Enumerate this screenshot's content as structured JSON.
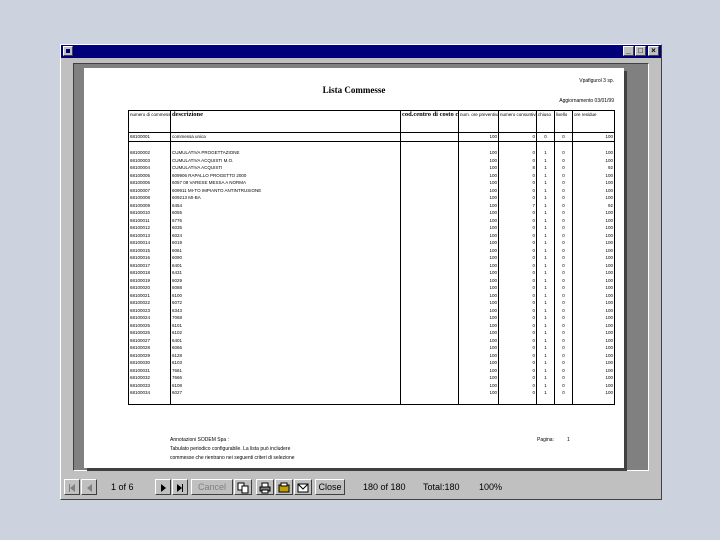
{
  "window": {
    "buttons": {
      "minimize": "_",
      "maximize": "□",
      "close": "×"
    }
  },
  "report": {
    "company": "Vpafigurol 3 sp.",
    "title": "Lista Commesse",
    "updated": "Aggiornamento 03/01/99",
    "columns": [
      {
        "label": "numero di commessa"
      },
      {
        "label": "descrizione"
      },
      {
        "label": "cod.centro di costo cliente"
      },
      {
        "label": "num. ore preventivate"
      },
      {
        "label": "numero consuntivi"
      },
      {
        "label": "chiuso"
      },
      {
        "label": "livello"
      },
      {
        "label": "ore residue"
      }
    ],
    "rows": [
      {
        "code": "68100001",
        "desc": "commessa unica",
        "cdc": "",
        "ore": "100",
        "cons": "0",
        "chiuso": "0",
        "liv": "0",
        "res": "100"
      },
      {
        "code": "",
        "desc": "",
        "cdc": "",
        "ore": "",
        "cons": "",
        "chiuso": "",
        "liv": "",
        "res": ""
      },
      {
        "code": "68100002",
        "desc": "CUMULATIVA PROGETTAZIONE",
        "cdc": "",
        "ore": "100",
        "cons": "0",
        "chiuso": "1",
        "liv": "0",
        "res": "100"
      },
      {
        "code": "68100003",
        "desc": "CUMULATIVA ACQUISTI M.O.",
        "cdc": "",
        "ore": "100",
        "cons": "0",
        "chiuso": "1",
        "liv": "0",
        "res": "100"
      },
      {
        "code": "68100004",
        "desc": "CUMULATIVA ACQUISTI",
        "cdc": "",
        "ore": "100",
        "cons": "8",
        "chiuso": "1",
        "liv": "0",
        "res": "92"
      },
      {
        "code": "68100005",
        "desc": "609906 RAPALLO PROGETTO 2000",
        "cdc": "",
        "ore": "100",
        "cons": "0",
        "chiuso": "1",
        "liv": "0",
        "res": "100"
      },
      {
        "code": "68100006",
        "desc": "6057 08 VARESE MESSA A NORMA",
        "cdc": "",
        "ore": "100",
        "cons": "0",
        "chiuso": "1",
        "liv": "0",
        "res": "100"
      },
      {
        "code": "68100007",
        "desc": "609911 MI-TO IMPIANTO ANTINTRUSIONE",
        "cdc": "",
        "ore": "100",
        "cons": "0",
        "chiuso": "1",
        "liv": "0",
        "res": "100"
      },
      {
        "code": "68100008",
        "desc": "609213 MI-BA",
        "cdc": "",
        "ore": "100",
        "cons": "0",
        "chiuso": "1",
        "liv": "0",
        "res": "100"
      },
      {
        "code": "68100009",
        "desc": "6454",
        "cdc": "",
        "ore": "100",
        "cons": "7",
        "chiuso": "1",
        "liv": "0",
        "res": "92"
      },
      {
        "code": "68100010",
        "desc": "6055",
        "cdc": "",
        "ore": "100",
        "cons": "0",
        "chiuso": "1",
        "liv": "0",
        "res": "100"
      },
      {
        "code": "68100011",
        "desc": "6776",
        "cdc": "",
        "ore": "100",
        "cons": "0",
        "chiuso": "1",
        "liv": "0",
        "res": "100"
      },
      {
        "code": "68100012",
        "desc": "6035",
        "cdc": "",
        "ore": "100",
        "cons": "0",
        "chiuso": "1",
        "liv": "0",
        "res": "100"
      },
      {
        "code": "68100013",
        "desc": "6024",
        "cdc": "",
        "ore": "100",
        "cons": "0",
        "chiuso": "1",
        "liv": "0",
        "res": "100"
      },
      {
        "code": "68100014",
        "desc": "6019",
        "cdc": "",
        "ore": "100",
        "cons": "0",
        "chiuso": "1",
        "liv": "0",
        "res": "100"
      },
      {
        "code": "68100015",
        "desc": "6061",
        "cdc": "",
        "ore": "100",
        "cons": "0",
        "chiuso": "1",
        "liv": "0",
        "res": "100"
      },
      {
        "code": "68100016",
        "desc": "6090",
        "cdc": "",
        "ore": "100",
        "cons": "0",
        "chiuso": "1",
        "liv": "0",
        "res": "100"
      },
      {
        "code": "68100017",
        "desc": "6401",
        "cdc": "",
        "ore": "100",
        "cons": "0",
        "chiuso": "1",
        "liv": "0",
        "res": "100"
      },
      {
        "code": "68100018",
        "desc": "6431",
        "cdc": "",
        "ore": "100",
        "cons": "0",
        "chiuso": "1",
        "liv": "0",
        "res": "100"
      },
      {
        "code": "68100019",
        "desc": "6029",
        "cdc": "",
        "ore": "100",
        "cons": "0",
        "chiuso": "1",
        "liv": "0",
        "res": "100"
      },
      {
        "code": "68100020",
        "desc": "6088",
        "cdc": "",
        "ore": "100",
        "cons": "0",
        "chiuso": "1",
        "liv": "0",
        "res": "100"
      },
      {
        "code": "68100021",
        "desc": "6100",
        "cdc": "",
        "ore": "100",
        "cons": "0",
        "chiuso": "1",
        "liv": "0",
        "res": "100"
      },
      {
        "code": "68100022",
        "desc": "6072",
        "cdc": "",
        "ore": "100",
        "cons": "0",
        "chiuso": "1",
        "liv": "0",
        "res": "100"
      },
      {
        "code": "68100023",
        "desc": "6343",
        "cdc": "",
        "ore": "100",
        "cons": "0",
        "chiuso": "1",
        "liv": "0",
        "res": "100"
      },
      {
        "code": "68100024",
        "desc": "7068",
        "cdc": "",
        "ore": "100",
        "cons": "0",
        "chiuso": "1",
        "liv": "0",
        "res": "100"
      },
      {
        "code": "68100025",
        "desc": "6101",
        "cdc": "",
        "ore": "100",
        "cons": "0",
        "chiuso": "1",
        "liv": "0",
        "res": "100"
      },
      {
        "code": "68100026",
        "desc": "6102",
        "cdc": "",
        "ore": "100",
        "cons": "0",
        "chiuso": "1",
        "liv": "0",
        "res": "100"
      },
      {
        "code": "68100027",
        "desc": "6401",
        "cdc": "",
        "ore": "100",
        "cons": "0",
        "chiuso": "1",
        "liv": "0",
        "res": "100"
      },
      {
        "code": "68100028",
        "desc": "6066",
        "cdc": "",
        "ore": "100",
        "cons": "0",
        "chiuso": "1",
        "liv": "0",
        "res": "100"
      },
      {
        "code": "68100029",
        "desc": "6128",
        "cdc": "",
        "ore": "100",
        "cons": "0",
        "chiuso": "1",
        "liv": "0",
        "res": "100"
      },
      {
        "code": "68100030",
        "desc": "6103",
        "cdc": "",
        "ore": "100",
        "cons": "0",
        "chiuso": "1",
        "liv": "0",
        "res": "100"
      },
      {
        "code": "68100031",
        "desc": "7661",
        "cdc": "",
        "ore": "100",
        "cons": "0",
        "chiuso": "1",
        "liv": "0",
        "res": "100"
      },
      {
        "code": "68100032",
        "desc": "7666",
        "cdc": "",
        "ore": "100",
        "cons": "0",
        "chiuso": "1",
        "liv": "0",
        "res": "100"
      },
      {
        "code": "68100033",
        "desc": "6108",
        "cdc": "",
        "ore": "100",
        "cons": "0",
        "chiuso": "1",
        "liv": "0",
        "res": "100"
      },
      {
        "code": "68100034",
        "desc": "6027",
        "cdc": "",
        "ore": "100",
        "cons": "0",
        "chiuso": "1",
        "liv": "0",
        "res": "100"
      },
      {
        "code": "",
        "desc": "",
        "cdc": "",
        "ore": "",
        "cons": "",
        "chiuso": "",
        "liv": "",
        "res": ""
      }
    ],
    "footer": {
      "line1": "Annotazioni SODEM Spa :",
      "line2": "Tabulato periodico configurabile. La lista può includere",
      "line3": "commesse che rientrano nei seguenti criteri di selezione",
      "pages_label": "Pagina:",
      "pages_value": "1"
    }
  },
  "toolbar": {
    "page_indicator": "1 of 6",
    "cancel_label": "Cancel",
    "close_label": "Close",
    "records": "180 of 180",
    "total": "Total:180",
    "zoom": "100%"
  }
}
